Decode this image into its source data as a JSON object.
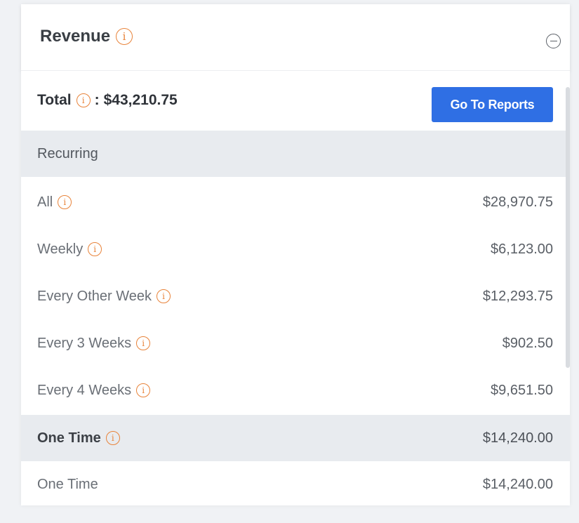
{
  "header": {
    "title": "Revenue",
    "info_icon": "info-icon",
    "collapse_icon": "collapse-minus-icon"
  },
  "total": {
    "label": "Total",
    "separator": ":",
    "value": "$43,210.75",
    "button_label": "Go To Reports"
  },
  "sections": [
    {
      "title": "Recurring",
      "amount": "",
      "items": [
        {
          "label": "All",
          "amount": "$28,970.75"
        },
        {
          "label": "Weekly",
          "amount": "$6,123.00"
        },
        {
          "label": "Every Other Week",
          "amount": "$12,293.75"
        },
        {
          "label": "Every 3 Weeks",
          "amount": "$902.50"
        },
        {
          "label": "Every 4 Weeks",
          "amount": "$9,651.50"
        }
      ]
    },
    {
      "title": "One Time",
      "amount": "$14,240.00",
      "items": [
        {
          "label": "One Time",
          "amount": "$14,240.00"
        }
      ]
    }
  ],
  "colors": {
    "accent": "#2f6fe4",
    "info": "#e8833a",
    "section_bg": "#e8ebef"
  }
}
